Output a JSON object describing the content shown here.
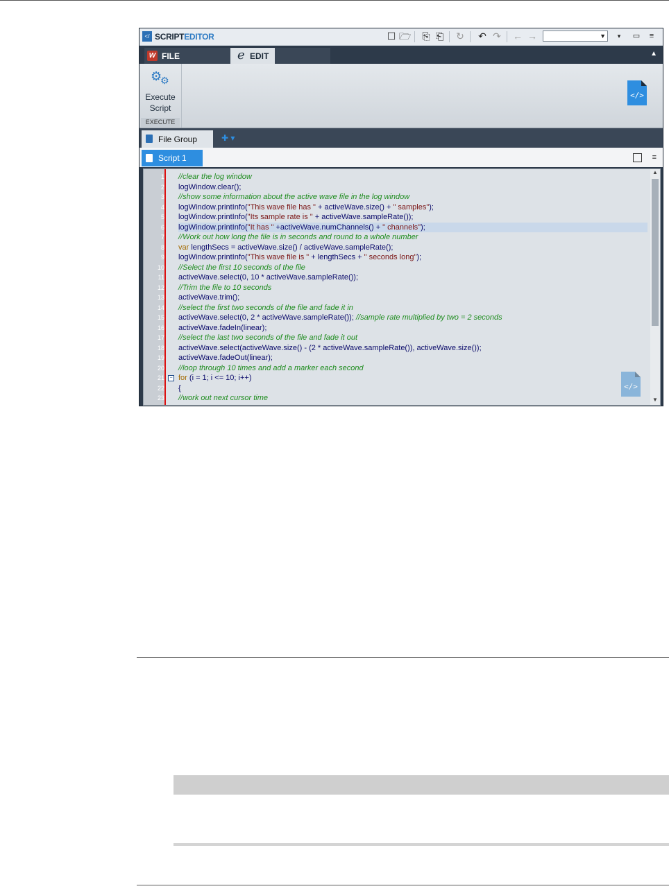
{
  "app": {
    "title_part1": "SCRIPT",
    "title_part2": "EDITOR"
  },
  "tabs": {
    "file": "FILE",
    "edit": "EDIT"
  },
  "ribbon": {
    "execute_line1": "Execute",
    "execute_line2": "Script",
    "group_label": "EXECUTE"
  },
  "file_group_tab": "File Group",
  "script_tab": "Script 1",
  "code_lines": [
    {
      "n": "1",
      "t": "//clear the log window"
    },
    {
      "n": "2",
      "t": "logWindow.clear();"
    },
    {
      "n": "3",
      "t": "//show some information about the active wave file in the log window"
    },
    {
      "n": "4",
      "t": "logWindow.printInfo(\"This wave file has \" + activeWave.size() + \" samples\");"
    },
    {
      "n": "5",
      "t": "logWindow.printInfo(\"Its sample rate is \" + activeWave.sampleRate());"
    },
    {
      "n": "6",
      "t": "logWindow.printInfo(\"It has \" +activeWave.numChannels() + \" channels\");"
    },
    {
      "n": "7",
      "t": "//Work out how long the file is in seconds and round to a whole number"
    },
    {
      "n": "8",
      "t": "var lengthSecs = activeWave.size() / activeWave.sampleRate();"
    },
    {
      "n": "9",
      "t": "logWindow.printInfo(\"This wave file is \" + lengthSecs + \" seconds long\");"
    },
    {
      "n": "10",
      "t": "//Select the first 10 seconds of the file"
    },
    {
      "n": "11",
      "t": "activeWave.select(0, 10 * activeWave.sampleRate());"
    },
    {
      "n": "12",
      "t": "//Trim the file to 10 seconds"
    },
    {
      "n": "13",
      "t": "activeWave.trim();"
    },
    {
      "n": "14",
      "t": "//select the first two seconds of the file and fade it in"
    },
    {
      "n": "15",
      "t": "activeWave.select(0, 2 * activeWave.sampleRate()); //sample rate multiplied by two = 2 seconds"
    },
    {
      "n": "16",
      "t": "activeWave.fadeIn(linear);"
    },
    {
      "n": "17",
      "t": "//select the last two seconds of the file and fade it out"
    },
    {
      "n": "18",
      "t": "activeWave.select(activeWave.size() - (2 * activeWave.sampleRate()), activeWave.size());"
    },
    {
      "n": "19",
      "t": "activeWave.fadeOut(linear);"
    },
    {
      "n": "20",
      "t": "//loop through 10 times and add a marker each second"
    },
    {
      "n": "21",
      "t": "for (i = 1; i <= 10; i++)"
    },
    {
      "n": "22",
      "t": "{"
    },
    {
      "n": "23",
      "t": "//work out next cursor time"
    }
  ],
  "colors": {
    "accent": "#2e8ee0",
    "comment": "#1e8c1e",
    "keyword": "#a36a00",
    "string": "#7a1515",
    "code": "#0a0a6a"
  },
  "icons": [
    "new-file-icon",
    "open-folder-icon",
    "paste-icon",
    "paste-special-icon",
    "refresh-icon",
    "undo-icon",
    "redo-icon",
    "back-arrow-icon",
    "forward-arrow-icon",
    "dropdown-icon",
    "minimize-icon",
    "layout-icon",
    "collapse-ribbon-icon",
    "gears-icon",
    "script-doc-icon"
  ]
}
